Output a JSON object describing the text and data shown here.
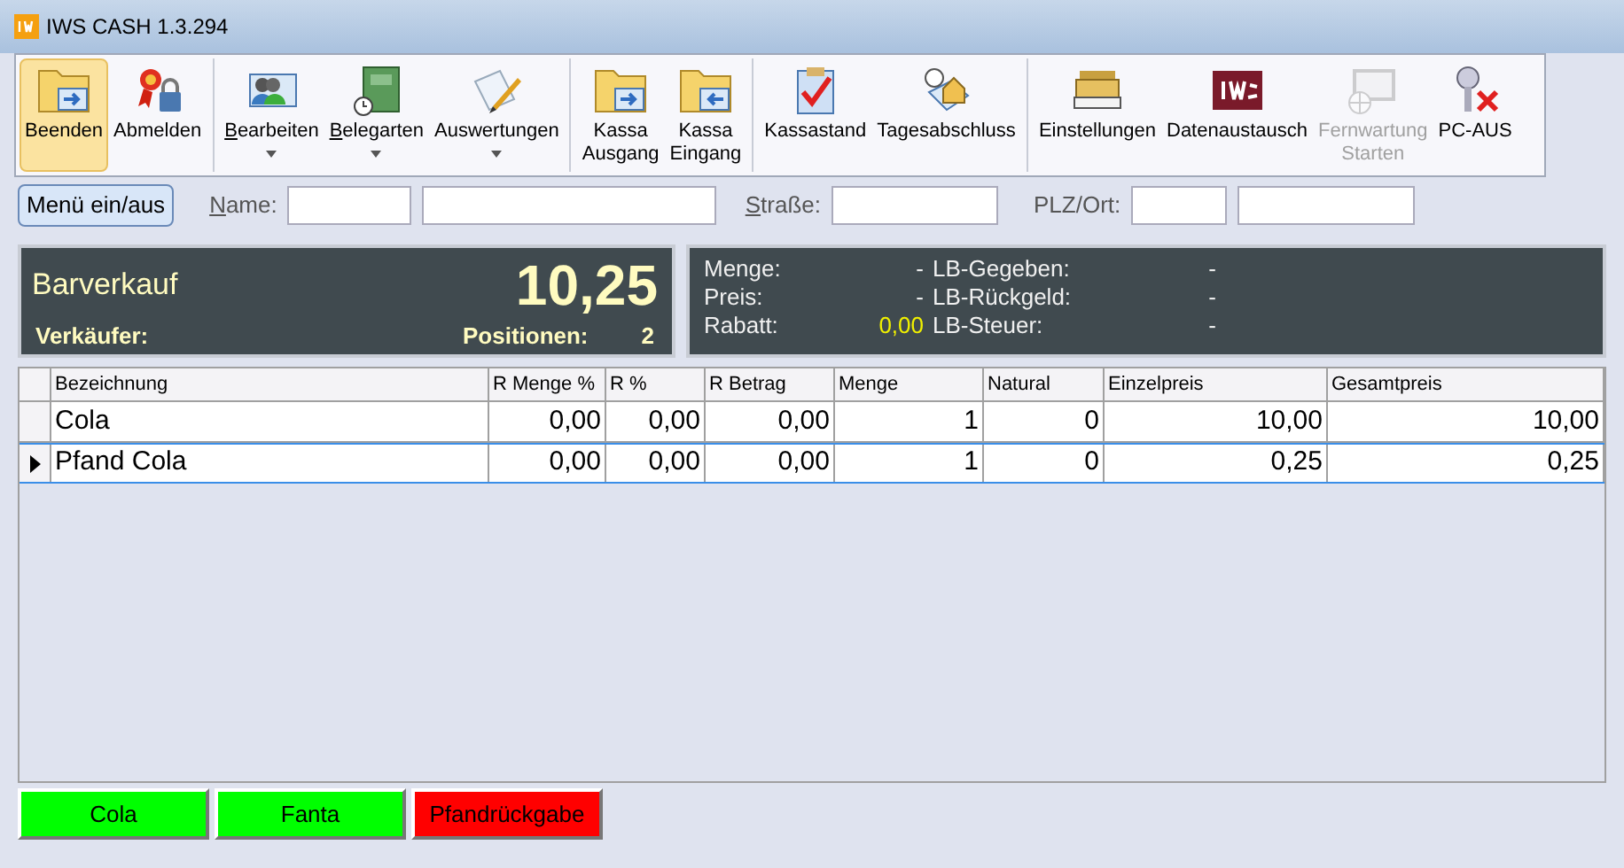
{
  "window": {
    "title": "IWS CASH 1.3.294"
  },
  "toolbar": {
    "groups": [
      [
        {
          "label": "Beenden",
          "selected": true,
          "disabled": false,
          "dropdown": false,
          "mnemonic": false
        },
        {
          "label": "Abmelden",
          "selected": false,
          "disabled": false,
          "dropdown": false,
          "mnemonic": false
        }
      ],
      [
        {
          "label": "Bearbeiten",
          "selected": false,
          "disabled": false,
          "dropdown": true,
          "mnemonic": true
        },
        {
          "label": "Belegarten",
          "selected": false,
          "disabled": false,
          "dropdown": true,
          "mnemonic": true
        },
        {
          "label": "Auswertungen",
          "selected": false,
          "disabled": false,
          "dropdown": true,
          "mnemonic": false
        }
      ],
      [
        {
          "label": "Kassa\nAusgang",
          "selected": false,
          "disabled": false,
          "dropdown": false,
          "mnemonic": false
        },
        {
          "label": "Kassa\nEingang",
          "selected": false,
          "disabled": false,
          "dropdown": false,
          "mnemonic": false
        }
      ],
      [
        {
          "label": "Kassastand",
          "selected": false,
          "disabled": false,
          "dropdown": false,
          "mnemonic": false
        },
        {
          "label": "Tagesabschluss",
          "selected": false,
          "disabled": false,
          "dropdown": false,
          "mnemonic": false
        }
      ],
      [
        {
          "label": "Einstellungen",
          "selected": false,
          "disabled": false,
          "dropdown": false,
          "mnemonic": false
        },
        {
          "label": "Datenaustausch",
          "selected": false,
          "disabled": false,
          "dropdown": false,
          "mnemonic": false
        },
        {
          "label": "Fernwartung\nStarten",
          "selected": false,
          "disabled": true,
          "dropdown": false,
          "mnemonic": false
        },
        {
          "label": "PC-AUS",
          "selected": false,
          "disabled": false,
          "dropdown": false,
          "mnemonic": false
        }
      ]
    ]
  },
  "address_bar": {
    "menu_button": "Menü ein/aus",
    "fields": [
      {
        "label": "Name:",
        "mnemonic": true
      },
      {
        "label": "Straße:",
        "mnemonic": true
      },
      {
        "label": "PLZ/Ort:",
        "mnemonic": false
      }
    ]
  },
  "summary": {
    "title": "Barverkauf",
    "total": "10,25",
    "seller_label": "Verkäufer:",
    "positions_label": "Positionen:",
    "positions": "2"
  },
  "details": {
    "left": [
      {
        "label": "Menge:",
        "value": "-",
        "highlight": false
      },
      {
        "label": "Preis:",
        "value": "-",
        "highlight": false
      },
      {
        "label": "Rabatt:",
        "value": "0,00",
        "highlight": true
      }
    ],
    "right": [
      {
        "label": "LB-Gegeben:",
        "value": "-"
      },
      {
        "label": "LB-Rückgeld:",
        "value": "-"
      },
      {
        "label": "LB-Steuer:",
        "value": "-"
      }
    ]
  },
  "table": {
    "columns": [
      "Bezeichnung",
      "R Menge %",
      "R %",
      "R Betrag",
      "Menge",
      "Natural",
      "Einzelpreis",
      "Gesamtpreis"
    ],
    "rows": [
      {
        "selected": false,
        "cells": [
          "Cola",
          "0,00",
          "0,00",
          "0,00",
          "1",
          "0",
          "10,00",
          "10,00"
        ]
      },
      {
        "selected": true,
        "cells": [
          "Pfand Cola",
          "0,00",
          "0,00",
          "0,00",
          "1",
          "0",
          "0,25",
          "0,25"
        ]
      }
    ]
  },
  "quick_buttons": [
    {
      "label": "Cola",
      "color": "#00ff00"
    },
    {
      "label": "Fanta",
      "color": "#00ff00"
    },
    {
      "label": "Pfandrückgabe",
      "color": "#ff0000"
    }
  ]
}
